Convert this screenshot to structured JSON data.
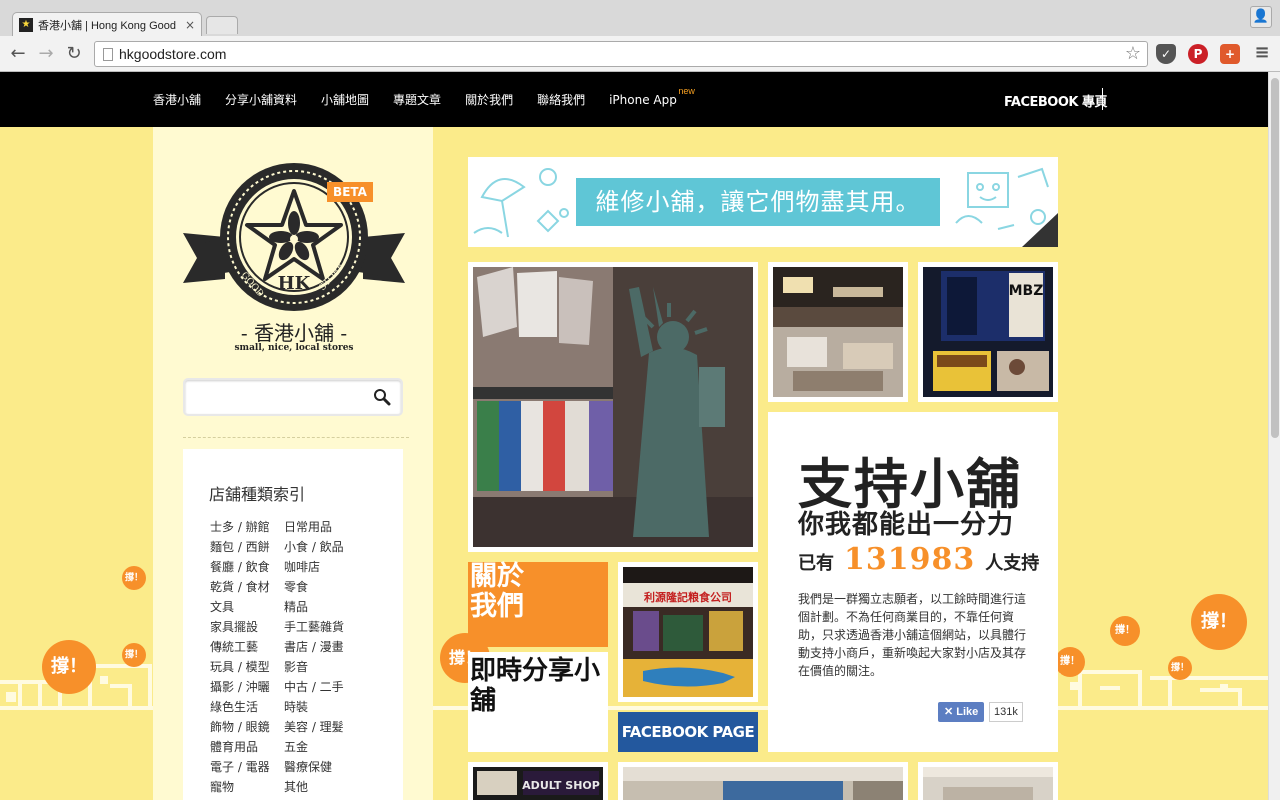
{
  "browser": {
    "tab_title": "香港小舖 | Hong Kong Good",
    "tab_close": "×",
    "url": "hkgoodstore.com"
  },
  "nav": {
    "items": [
      "香港小舖",
      "分享小舖資料",
      "小舖地圖",
      "專題文章",
      "關於我們",
      "聯絡我們",
      "iPhone App"
    ],
    "new_badge": "new",
    "facebook": "FACEBOOK 專頁"
  },
  "sidebar": {
    "beta": "BETA",
    "logo_hk": "HK",
    "logo_good": "GOOD",
    "logo_store": "STORE",
    "brand": "- 香港小舖 -",
    "tagline": "small, nice, local stores",
    "search_placeholder": "",
    "category_title": "店舖種類索引",
    "categories_col1": [
      "士多 / 辦館",
      "麵包 / 西餅",
      "餐廳 / 飲食",
      "乾貨 / 食材",
      "文具",
      "家具擺設",
      "傳統工藝",
      "玩具 / 模型",
      "攝影 / 沖曬",
      "綠色生活",
      "飾物 / 眼鏡",
      "體育用品",
      "電子 / 電器",
      "寵物"
    ],
    "categories_col2": [
      "日常用品",
      "小食 / 飲品",
      "咖啡店",
      "零食",
      "精品",
      "手工藝雜貨",
      "書店 / 漫畫",
      "影音",
      "中古 / 二手",
      "時裝",
      "美容 / 理髮",
      "五金",
      "醫療保健",
      "其他"
    ]
  },
  "banner": {
    "slogan": "維修小舖，讓它們物盡其用。"
  },
  "support": {
    "headline": "支持小舖",
    "subhead": "你我都能出一分力",
    "count_prefix": "已有",
    "count": "131983",
    "count_suffix": "人支持",
    "description": "我們是一群獨立志願者，以工餘時間進行這個計劃。不為任何商業目的，不靠任何資助，只求透過香港小舖這個網站，以具體行動支持小商戶，重新喚起大家對小店及其存在價值的關注。",
    "like_label": "Like",
    "like_count": "131k"
  },
  "tiles": {
    "about": "關於我們",
    "share": "即時分享小舖",
    "facebook_page": "FACEBOOK PAGE",
    "photo_sign_1": "MBZ",
    "photo_sign_2": "利源隆記粮食公司",
    "photo_sign_3": "ADULT SHOP"
  },
  "decor": {
    "bubble_text": "撐！",
    "bubble_mark": "!"
  },
  "colors": {
    "background": "#fbeb8a",
    "accent_orange": "#f7902a",
    "banner_cyan": "#5fc6d6",
    "facebook_blue": "#23589e"
  }
}
